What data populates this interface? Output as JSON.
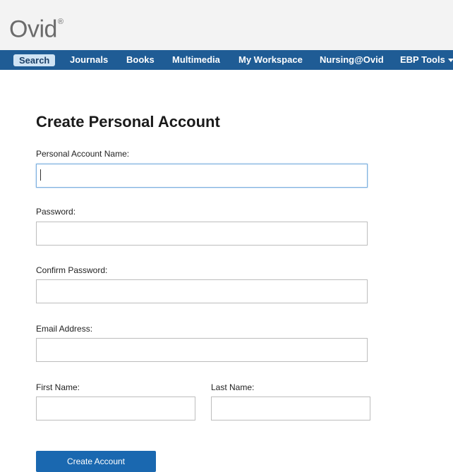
{
  "brand": {
    "name": "Ovid",
    "mark": "®"
  },
  "nav": {
    "items": [
      {
        "label": "Search",
        "active": true
      },
      {
        "label": "Journals"
      },
      {
        "label": "Books"
      },
      {
        "label": "Multimedia"
      },
      {
        "label": "My Workspace"
      },
      {
        "label": "Nursing@Ovid"
      },
      {
        "label": "EBP Tools",
        "has_dropdown": true
      }
    ]
  },
  "form": {
    "title": "Create Personal Account",
    "account_name_label": "Personal Account Name:",
    "account_name_value": "",
    "password_label": "Password:",
    "confirm_password_label": "Confirm Password:",
    "email_label": "Email Address:",
    "first_name_label": "First Name:",
    "last_name_label": "Last Name:",
    "submit_label": "Create Account"
  },
  "colors": {
    "nav_bg": "#1f5c95",
    "button_bg": "#1a68b0",
    "focus_border": "#7aaede"
  }
}
